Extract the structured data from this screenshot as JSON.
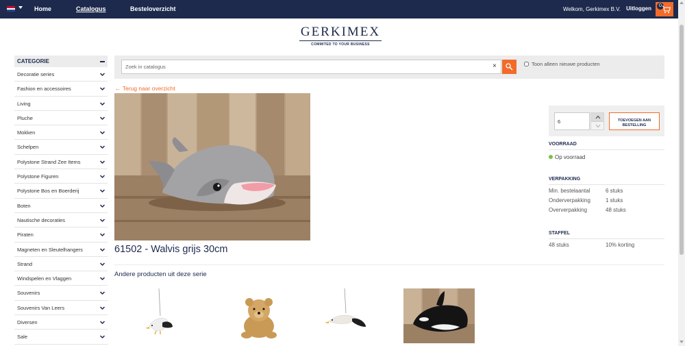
{
  "nav": {
    "home": "Home",
    "catalog": "Catalogus",
    "orders": "Besteloverzicht",
    "welcome": "Welkom, Gerkimex B.V.",
    "logout": "Uitloggen",
    "cart_count": "0"
  },
  "logo": {
    "name": "GERKIMEX",
    "tagline": "COMMITED TO YOUR BUSINESS"
  },
  "sidebar": {
    "title": "CATEGORIE",
    "items": [
      {
        "label": "Decoratie series"
      },
      {
        "label": "Fashion en accessoires"
      },
      {
        "label": "Living"
      },
      {
        "label": "Pluche"
      },
      {
        "label": "Mokken"
      },
      {
        "label": "Schelpen"
      },
      {
        "label": "Polystone Strand Zee Items"
      },
      {
        "label": "Polystone Figuren"
      },
      {
        "label": "Polystone Bos en Boerderij"
      },
      {
        "label": "Boten"
      },
      {
        "label": "Nautische decoraties"
      },
      {
        "label": "Piraten"
      },
      {
        "label": "Magneten en Sleutelhangers"
      },
      {
        "label": "Strand"
      },
      {
        "label": "Windspelen en Vlaggen"
      },
      {
        "label": "Souvenirs"
      },
      {
        "label": "Souvenirs Van Leers"
      },
      {
        "label": "Diversen"
      },
      {
        "label": "Sale"
      }
    ]
  },
  "search": {
    "placeholder": "Zoek in catalogus",
    "clear": "×",
    "new_only_label": "Toon alleen nieuwe producten"
  },
  "back_link": "Terug naar overzicht",
  "product": {
    "title": "61502 - Walvis grijs 30cm",
    "quantity": "6",
    "add_button": "TOEVOEGEN AAN BESTELLING"
  },
  "stock": {
    "heading": "VOORRAAD",
    "status": "Op voorraad"
  },
  "packaging": {
    "heading": "VERPAKKING",
    "rows": [
      {
        "label": "Min. bestelaantal",
        "value": "6 stuks"
      },
      {
        "label": "Onderverpakking",
        "value": "1 stuks"
      },
      {
        "label": "Oververpakking",
        "value": "48 stuks"
      }
    ]
  },
  "staffel": {
    "heading": "STAFFEL",
    "rows": [
      {
        "label": "48 stuks",
        "value": "10% korting"
      }
    ]
  },
  "series": {
    "title": "Andere producten uit deze serie"
  },
  "colors": {
    "navy": "#1d2a4d",
    "accent": "#f26b2a",
    "in_stock": "#7bc144"
  }
}
